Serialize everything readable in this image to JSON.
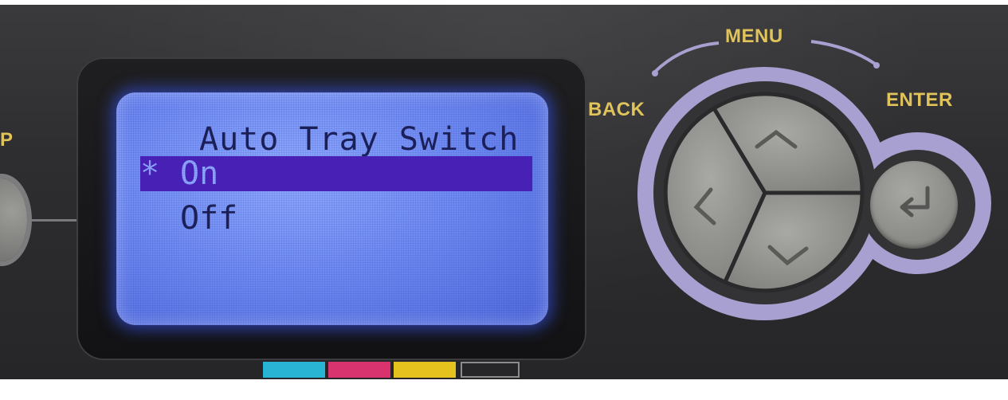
{
  "panel": {
    "left_label": "P",
    "nav_labels": {
      "menu": "MENU",
      "back": "BACK",
      "enter": "ENTER"
    }
  },
  "lcd": {
    "title": "Auto Tray Switch",
    "options": [
      {
        "marker": "*",
        "label": "On",
        "selected": true
      },
      {
        "marker": "",
        "label": "Off",
        "selected": false
      }
    ]
  },
  "toner_indicators": [
    {
      "name": "cyan",
      "color": "#29b4d4"
    },
    {
      "name": "magenta",
      "color": "#d8336e"
    },
    {
      "name": "yellow",
      "color": "#e6c21e"
    },
    {
      "name": "black",
      "color": "#8c8c8c"
    }
  ],
  "colors": {
    "label": "#e0c35a",
    "lcd_backlight": "#6f8bf4",
    "lcd_highlight": "#4a1fb8",
    "nav_ring": "#a8a0d0",
    "button": "#9a9a96"
  },
  "icons": {
    "up": "chevron-up-icon",
    "left": "chevron-left-icon",
    "down": "chevron-down-icon",
    "enter": "return-arrow-icon"
  }
}
